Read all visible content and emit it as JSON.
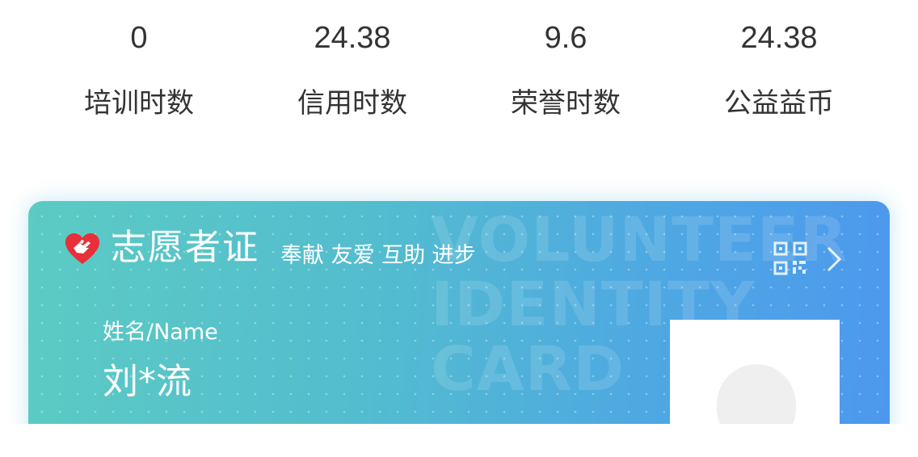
{
  "stats": [
    {
      "value": "0",
      "label": "培训时数"
    },
    {
      "value": "24.38",
      "label": "信用时数"
    },
    {
      "value": "9.6",
      "label": "荣誉时数"
    },
    {
      "value": "24.38",
      "label": "公益益币"
    }
  ],
  "card": {
    "title": "志愿者证",
    "slogan": "奉献 友爱 互助 进步",
    "watermark": [
      "VOLUNTEER",
      "IDENTITY",
      "CARD"
    ],
    "name_label": "姓名/Name",
    "name_value": "刘*流",
    "icons": {
      "logo": "heart-hand-icon",
      "qr": "qr-code-icon",
      "arrow": "chevron-right-icon"
    },
    "colors": {
      "gradient_start": "#5ccbc3",
      "gradient_end": "#4d98ee",
      "heart": "#e8303a"
    }
  }
}
